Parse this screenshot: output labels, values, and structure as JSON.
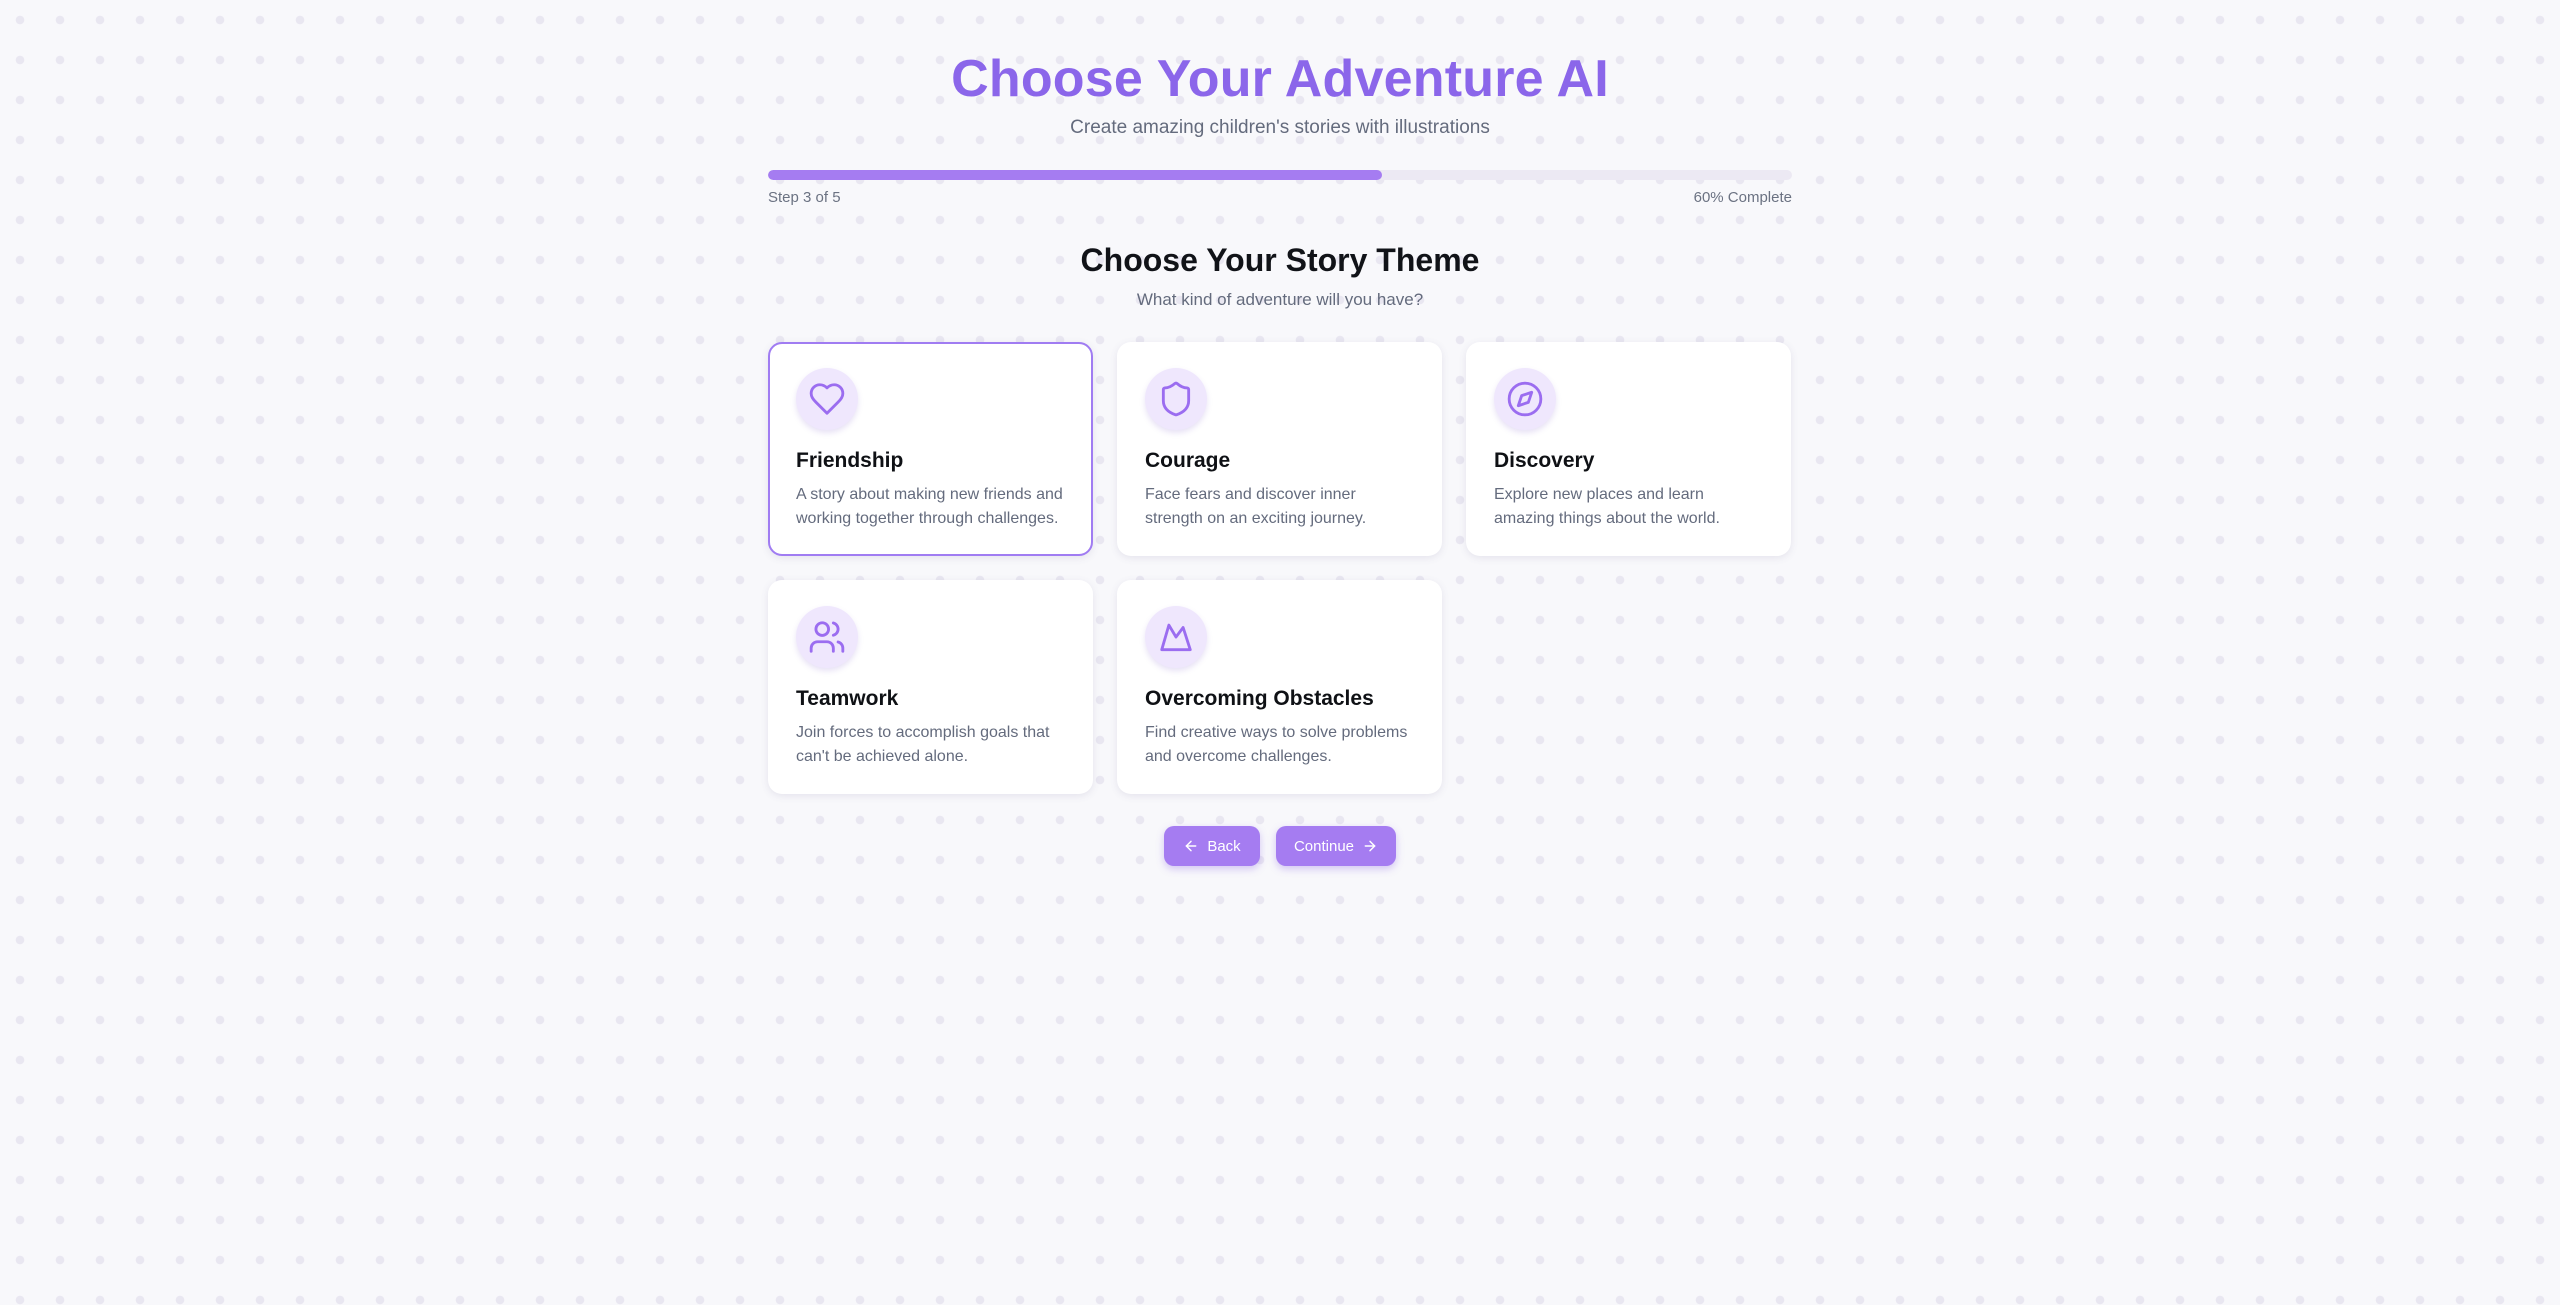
{
  "header": {
    "title": "Choose Your Adventure AI",
    "subtitle": "Create amazing children's stories with illustrations"
  },
  "progress": {
    "step_label": "Step 3 of 5",
    "percent_label": "60% Complete",
    "fraction": 0.6
  },
  "section": {
    "title": "Choose Your Story Theme",
    "subtitle": "What kind of adventure will you have?"
  },
  "themes": [
    {
      "title": "Friendship",
      "description": "A story about making new friends and working together through challenges.",
      "icon": "heart-icon",
      "selected": true
    },
    {
      "title": "Courage",
      "description": "Face fears and discover inner strength on an exciting journey.",
      "icon": "shield-icon",
      "selected": false
    },
    {
      "title": "Discovery",
      "description": "Explore new places and learn amazing things about the world.",
      "icon": "compass-icon",
      "selected": false
    },
    {
      "title": "Teamwork",
      "description": "Join forces to accomplish goals that can't be achieved alone.",
      "icon": "users-icon",
      "selected": false
    },
    {
      "title": "Overcoming Obstacles",
      "description": "Find creative ways to solve problems and overcome challenges.",
      "icon": "mountain-icon",
      "selected": false
    }
  ],
  "actions": {
    "back_label": "Back",
    "continue_label": "Continue"
  },
  "colors": {
    "accent": "#a57cf1",
    "title": "#8b66ea",
    "icon_bg": "#efe7fd",
    "selected_border": "#a07cf2"
  }
}
